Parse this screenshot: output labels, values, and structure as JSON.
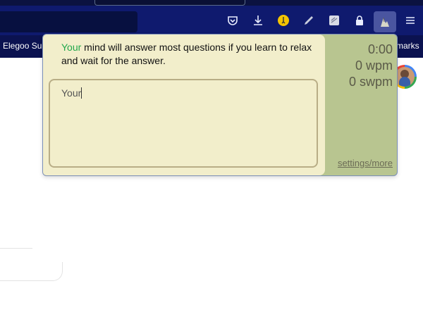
{
  "bookmarks": {
    "left_item": "Elegoo Sup",
    "right_item": "marks"
  },
  "toolbar": {
    "icons": [
      "pocket-icon",
      "download-icon",
      "extension-badge-icon",
      "pen-icon",
      "notes-icon",
      "lock-icon",
      "typing-extension-icon",
      "menu-icon"
    ]
  },
  "popup": {
    "prompt_typed": "Your",
    "prompt_rest": " mind will answer most questions if you learn to relax and wait for the answer.",
    "input_value": "Your",
    "timer": "0:00",
    "wpm": "0 wpm",
    "swpm": "0 swpm",
    "settings_link": "settings/more"
  },
  "colors": {
    "chrome": "#0f1a6e",
    "popup_bg": "#f2eecb",
    "sidebar_bg": "#b8c590",
    "typed_text": "#22a84c"
  }
}
